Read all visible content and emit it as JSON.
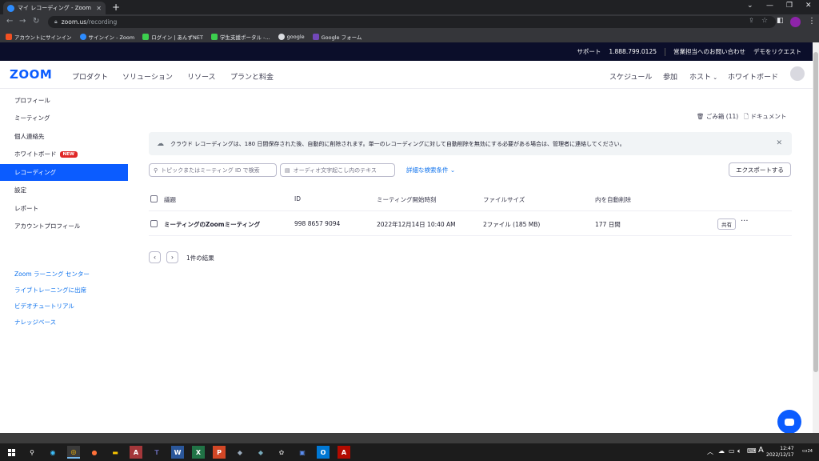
{
  "browser": {
    "tab_title": "マイ レコーディング - Zoom",
    "new_tab": "+",
    "url_host": "zoom.us",
    "url_path": "/recording",
    "bookmarks": [
      {
        "label": "アカウントにサインイン",
        "color": "#f25022"
      },
      {
        "label": "サインイン - Zoom",
        "color": "#2d8cff"
      },
      {
        "label": "ログイン | あんずNET",
        "color": "#3ccf4e"
      },
      {
        "label": "学生支援ポータル -...",
        "color": "#3ccf4e"
      },
      {
        "label": "google",
        "color": "#dadce0"
      },
      {
        "label": "Google フォーム",
        "color": "#7248b9"
      }
    ]
  },
  "utility_bar": {
    "support": "サポート",
    "phone": "1.888.799.0125",
    "contact_sales": "営業担当へのお問い合わせ",
    "request_demo": "デモをリクエスト"
  },
  "header": {
    "logo": "ZOOM",
    "nav": [
      "プロダクト",
      "ソリューション",
      "リソース",
      "プランと料金"
    ],
    "right_nav": [
      "スケジュール",
      "参加",
      "ホスト",
      "ホワイトボード"
    ]
  },
  "sidebar": {
    "items": [
      {
        "label": "プロフィール"
      },
      {
        "label": "ミーティング"
      },
      {
        "label": "個人連絡先"
      },
      {
        "label": "ホワイトボード",
        "badge": "NEW"
      },
      {
        "label": "レコーディング",
        "active": true
      },
      {
        "label": "設定"
      },
      {
        "label": "レポート"
      },
      {
        "label": "アカウントプロフィール"
      }
    ],
    "links": [
      "Zoom ラーニング センター",
      "ライブトレーニングに出席",
      "ビデオチュートリアル",
      "ナレッジベース"
    ]
  },
  "main": {
    "trash_link": "ごみ箱 (11)",
    "docs_link": "ドキュメント",
    "banner_text": "クラウド レコーディングは、180 日間保存された後、自動的に削除されます。単一のレコーディングに対して自動削除を無効にする必要がある場合は、管理者に連絡してください。",
    "search_placeholder": "トピックまたはミーティング ID で検索",
    "transcript_placeholder": "オーディオ文字起こし内のテキス",
    "advanced_search": "詳細な検索条件",
    "export_button": "エクスポートする",
    "table": {
      "headers": [
        "議題",
        "ID",
        "ミーティング開始時刻",
        "ファイルサイズ",
        "内を自動削除"
      ],
      "rows": [
        {
          "topic": "ミーティングのZoomミーティング",
          "id": "998 8657 9094",
          "start": "2022年12月14日 10:40 AM",
          "size": "2ファイル (185 MB)",
          "auto_delete": "177 日間",
          "share": "共有",
          "more": "···"
        }
      ]
    },
    "results": "1件の結果"
  },
  "taskbar": {
    "time": "12:47",
    "date": "2022/12/17",
    "ime": "A",
    "notification_count": "24"
  }
}
